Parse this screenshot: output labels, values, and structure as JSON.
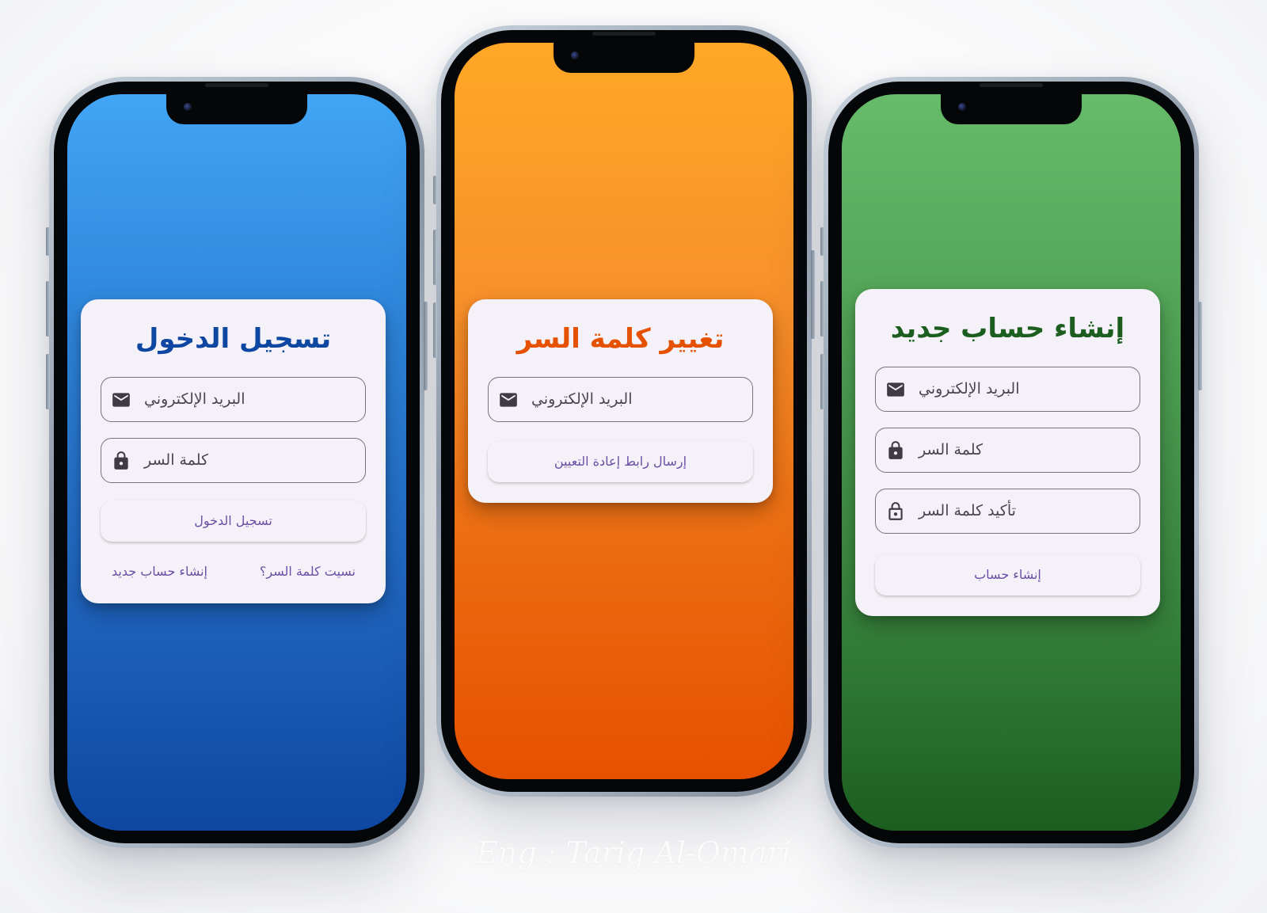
{
  "signature": "Eng : Tariq Al-Omari",
  "screens": {
    "login": {
      "title": "تسجيل الدخول",
      "email_placeholder": "البريد الإلكتروني",
      "password_placeholder": "كلمة السر",
      "submit_label": "تسجيل الدخول",
      "forgot_link": "نسيت كلمة السر؟",
      "register_link": "إنشاء حساب جديد",
      "gradient_top": "#42a5f5",
      "gradient_bottom": "#0d47a1",
      "title_color": "#0d47a1"
    },
    "reset": {
      "title": "تغيير كلمة السر",
      "email_placeholder": "البريد الإلكتروني",
      "submit_label": "إرسال رابط إعادة التعيين",
      "gradient_top": "#ffa726",
      "gradient_bottom": "#e65100",
      "title_color": "#e65100"
    },
    "register": {
      "title": "إنشاء حساب جديد",
      "email_placeholder": "البريد الإلكتروني",
      "password_placeholder": "كلمة السر",
      "confirm_placeholder": "تأكيد كلمة السر",
      "submit_label": "إنشاء حساب",
      "gradient_top": "#66bb6a",
      "gradient_bottom": "#1b5e20",
      "title_color": "#1b5e20"
    }
  },
  "icons": {
    "email": "email-icon",
    "lock": "lock-icon",
    "lock_outline": "lock-outline-icon"
  },
  "button_text_color": "#6a4fa5"
}
